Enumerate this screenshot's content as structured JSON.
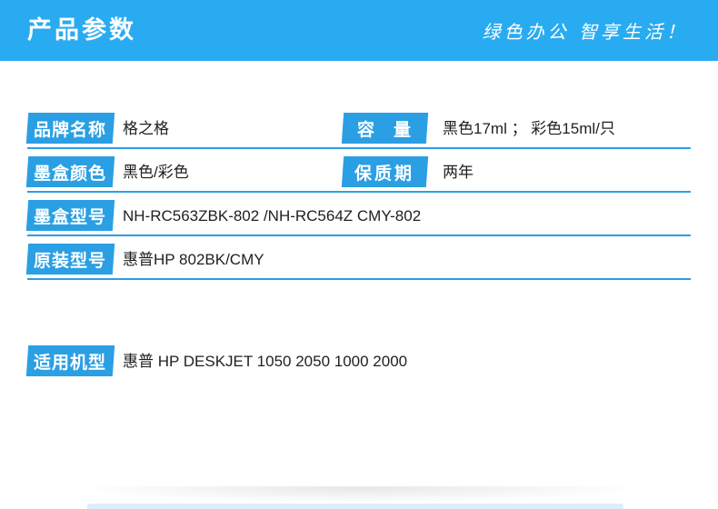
{
  "colors": {
    "header_blue": "#29abf2",
    "label_blue": "#2b9fe3",
    "divider_blue": "#2b9fe3",
    "text_dark": "#1f1f1f",
    "text_white": "#ffffff",
    "bottom_strip_blue": "#ddeefa"
  },
  "header": {
    "title": "产品参数",
    "slogan": "绿色办公 智享生活！"
  },
  "params": {
    "rows": [
      {
        "label": "品牌名称",
        "value": "格之格",
        "label2": "容　量",
        "value2": "黑色17ml ； 彩色15ml/只"
      },
      {
        "label": "墨盒颜色",
        "value": "黑色/彩色",
        "label2": "保质期",
        "value2": "两年"
      },
      {
        "label": "墨盒型号",
        "value": "NH-RC563ZBK-802 /NH-RC564Z CMY-802"
      },
      {
        "label": "原装型号",
        "value": "惠普HP 802BK/CMY"
      },
      {
        "label": "适用机型",
        "value": "惠普 HP DESKJET 1050 2050 1000 2000"
      }
    ]
  }
}
